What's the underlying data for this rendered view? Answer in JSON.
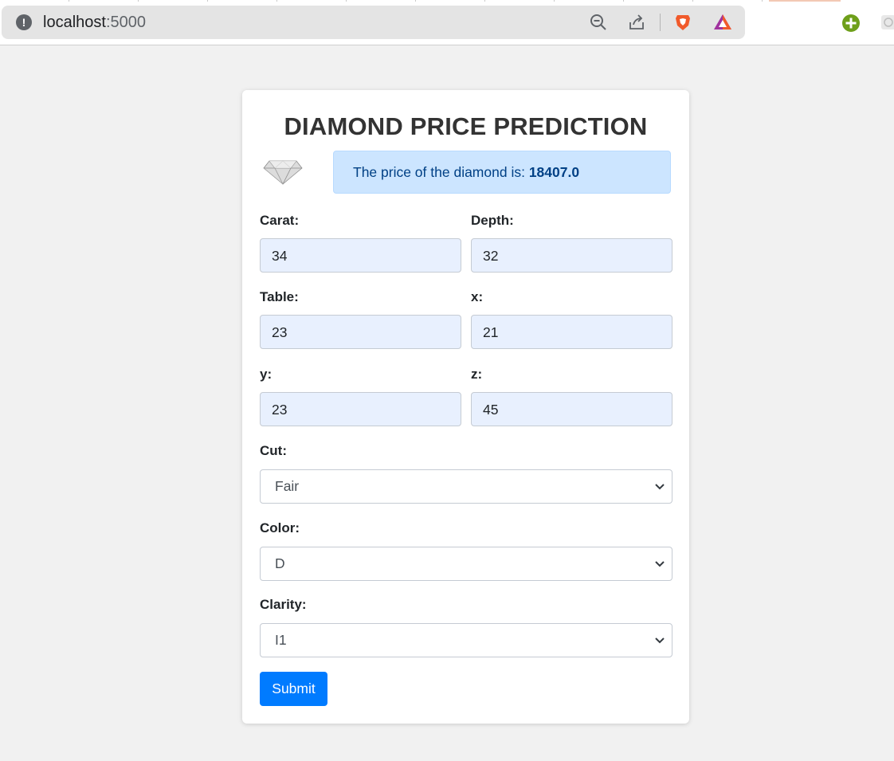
{
  "browser": {
    "url_host": "localhost",
    "url_port": ":5000"
  },
  "page": {
    "title": "DIAMOND PRICE PREDICTION",
    "result": {
      "prefix": "The price of the diamond is: ",
      "value": "18407.0"
    },
    "fields": {
      "carat": {
        "label": "Carat:",
        "value": "34"
      },
      "depth": {
        "label": "Depth:",
        "value": "32"
      },
      "table": {
        "label": "Table:",
        "value": "23"
      },
      "x": {
        "label": "x:",
        "value": "21"
      },
      "y": {
        "label": "y:",
        "value": "23"
      },
      "z": {
        "label": "z:",
        "value": "45"
      }
    },
    "selects": {
      "cut": {
        "label": "Cut:",
        "value": "Fair"
      },
      "color": {
        "label": "Color:",
        "value": "D"
      },
      "clarity": {
        "label": "Clarity:",
        "value": "I1"
      }
    },
    "submit_label": "Submit"
  },
  "colors": {
    "primary": "#007bff",
    "alert_bg": "#cce5ff",
    "alert_text": "#004085",
    "input_autofill_bg": "#e8f0fe"
  }
}
